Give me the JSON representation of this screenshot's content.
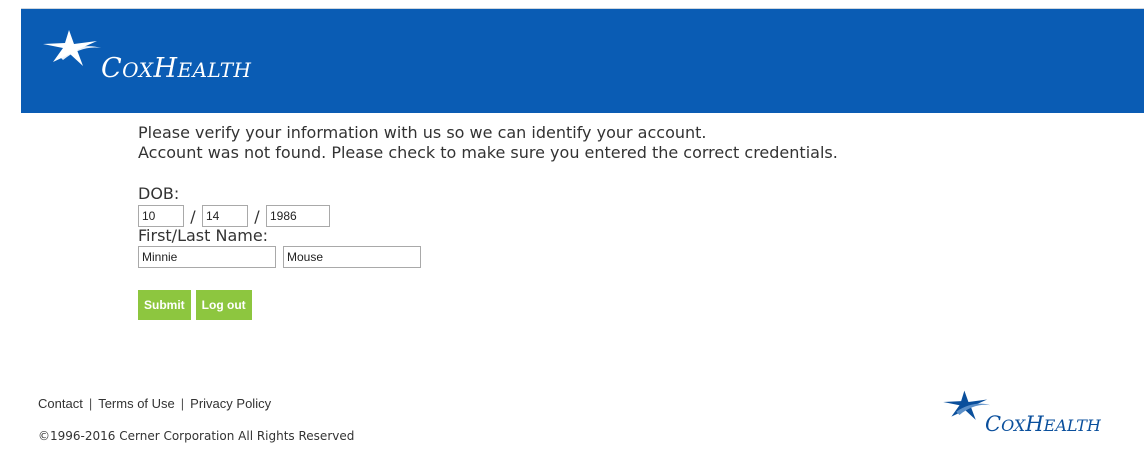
{
  "brand": {
    "logo_text_prefix": "C",
    "logo_text_rest": "OX",
    "logo_text_prefix2": "H",
    "logo_text_rest2": "EALTH",
    "header_color": "#0a5cb4",
    "logo_icon": "star-icon"
  },
  "messages": {
    "line1": "Please verify your information with us so we can identify your account.",
    "line2": "Account was not found. Please check to make sure you entered the correct credentials."
  },
  "form": {
    "dob_label": "DOB:",
    "dob_separator": "/",
    "month_value": "10",
    "day_value": "14",
    "year_value": "1986",
    "name_label": "First/Last Name:",
    "first_name_value": "Minnie",
    "last_name_value": "Mouse"
  },
  "buttons": {
    "submit_label": "Submit",
    "logout_label": "Log out",
    "button_color": "#8dc63f"
  },
  "footer": {
    "links": [
      "Contact",
      "Terms of Use",
      "Privacy Policy"
    ],
    "separator": "|",
    "copyright": "©1996-2016 Cerner Corporation All Rights Reserved"
  }
}
